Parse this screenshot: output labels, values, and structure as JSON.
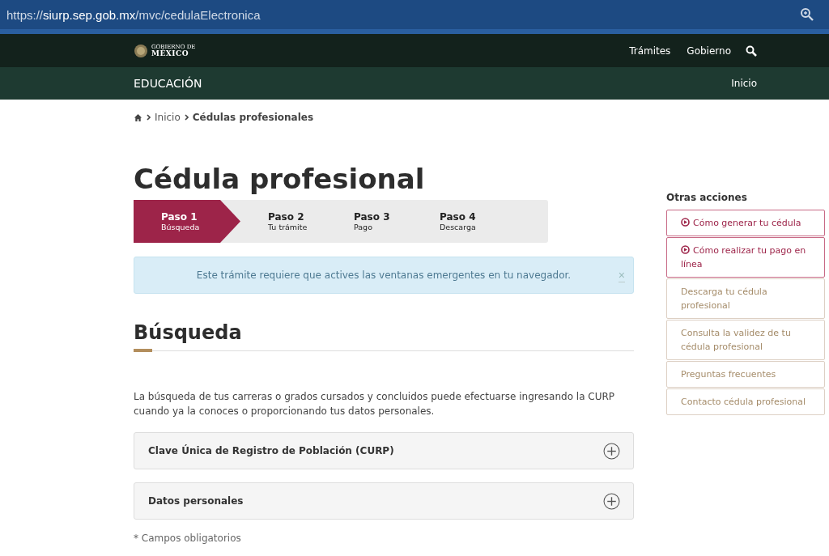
{
  "browser": {
    "url": {
      "scheme": "https://",
      "host": "siurp.sep.gob.mx",
      "path": "/mvc/cedulaElectronica"
    }
  },
  "header": {
    "logo": {
      "line1": "GOBIERNO DE",
      "line2": "MÉXICO"
    },
    "nav": [
      "Trámites",
      "Gobierno"
    ],
    "section": "EDUCACIÓN",
    "section_nav": [
      "Inicio"
    ]
  },
  "breadcrumb": [
    {
      "label": "Inicio",
      "current": false
    },
    {
      "label": "Cédulas profesionales",
      "current": true
    }
  ],
  "title": "Cédula profesional",
  "steps": [
    {
      "label": "Paso 1",
      "sub": "Búsqueda",
      "selected": true
    },
    {
      "label": "Paso 2",
      "sub": "Tu trámite",
      "selected": false
    },
    {
      "label": "Paso 3",
      "sub": "Pago",
      "selected": false
    },
    {
      "label": "Paso 4",
      "sub": "Descarga",
      "selected": false
    }
  ],
  "alert": {
    "text": "Este trámite requiere que actives las ventanas emergentes en tu navegador.",
    "close": "×"
  },
  "section_title": "Búsqueda",
  "intro": "La búsqueda de tus carreras o grados cursados y concluidos puede efectuarse ingresando la CURP cuando ya la conoces o proporcionando tus datos personales.",
  "accordions": [
    {
      "label": "Clave Única de Registro de Población (CURP)",
      "expanded": false
    },
    {
      "label": "Datos personales",
      "expanded": false
    }
  ],
  "required_note": "* Campos obligatorios",
  "sidebar": {
    "title": "Otras acciones",
    "links": [
      {
        "label": "Cómo generar tu cédula",
        "kind": "video"
      },
      {
        "label": "Cómo realizar tu pago en línea",
        "kind": "video"
      },
      {
        "label": "Descarga tu cédula profesional",
        "kind": "plain"
      },
      {
        "label": "Consulta la validez de tu cédula profesional",
        "kind": "plain"
      },
      {
        "label": "Preguntas frecuentes",
        "kind": "plain"
      },
      {
        "label": "Contacto cédula profesional",
        "kind": "plain"
      }
    ]
  }
}
